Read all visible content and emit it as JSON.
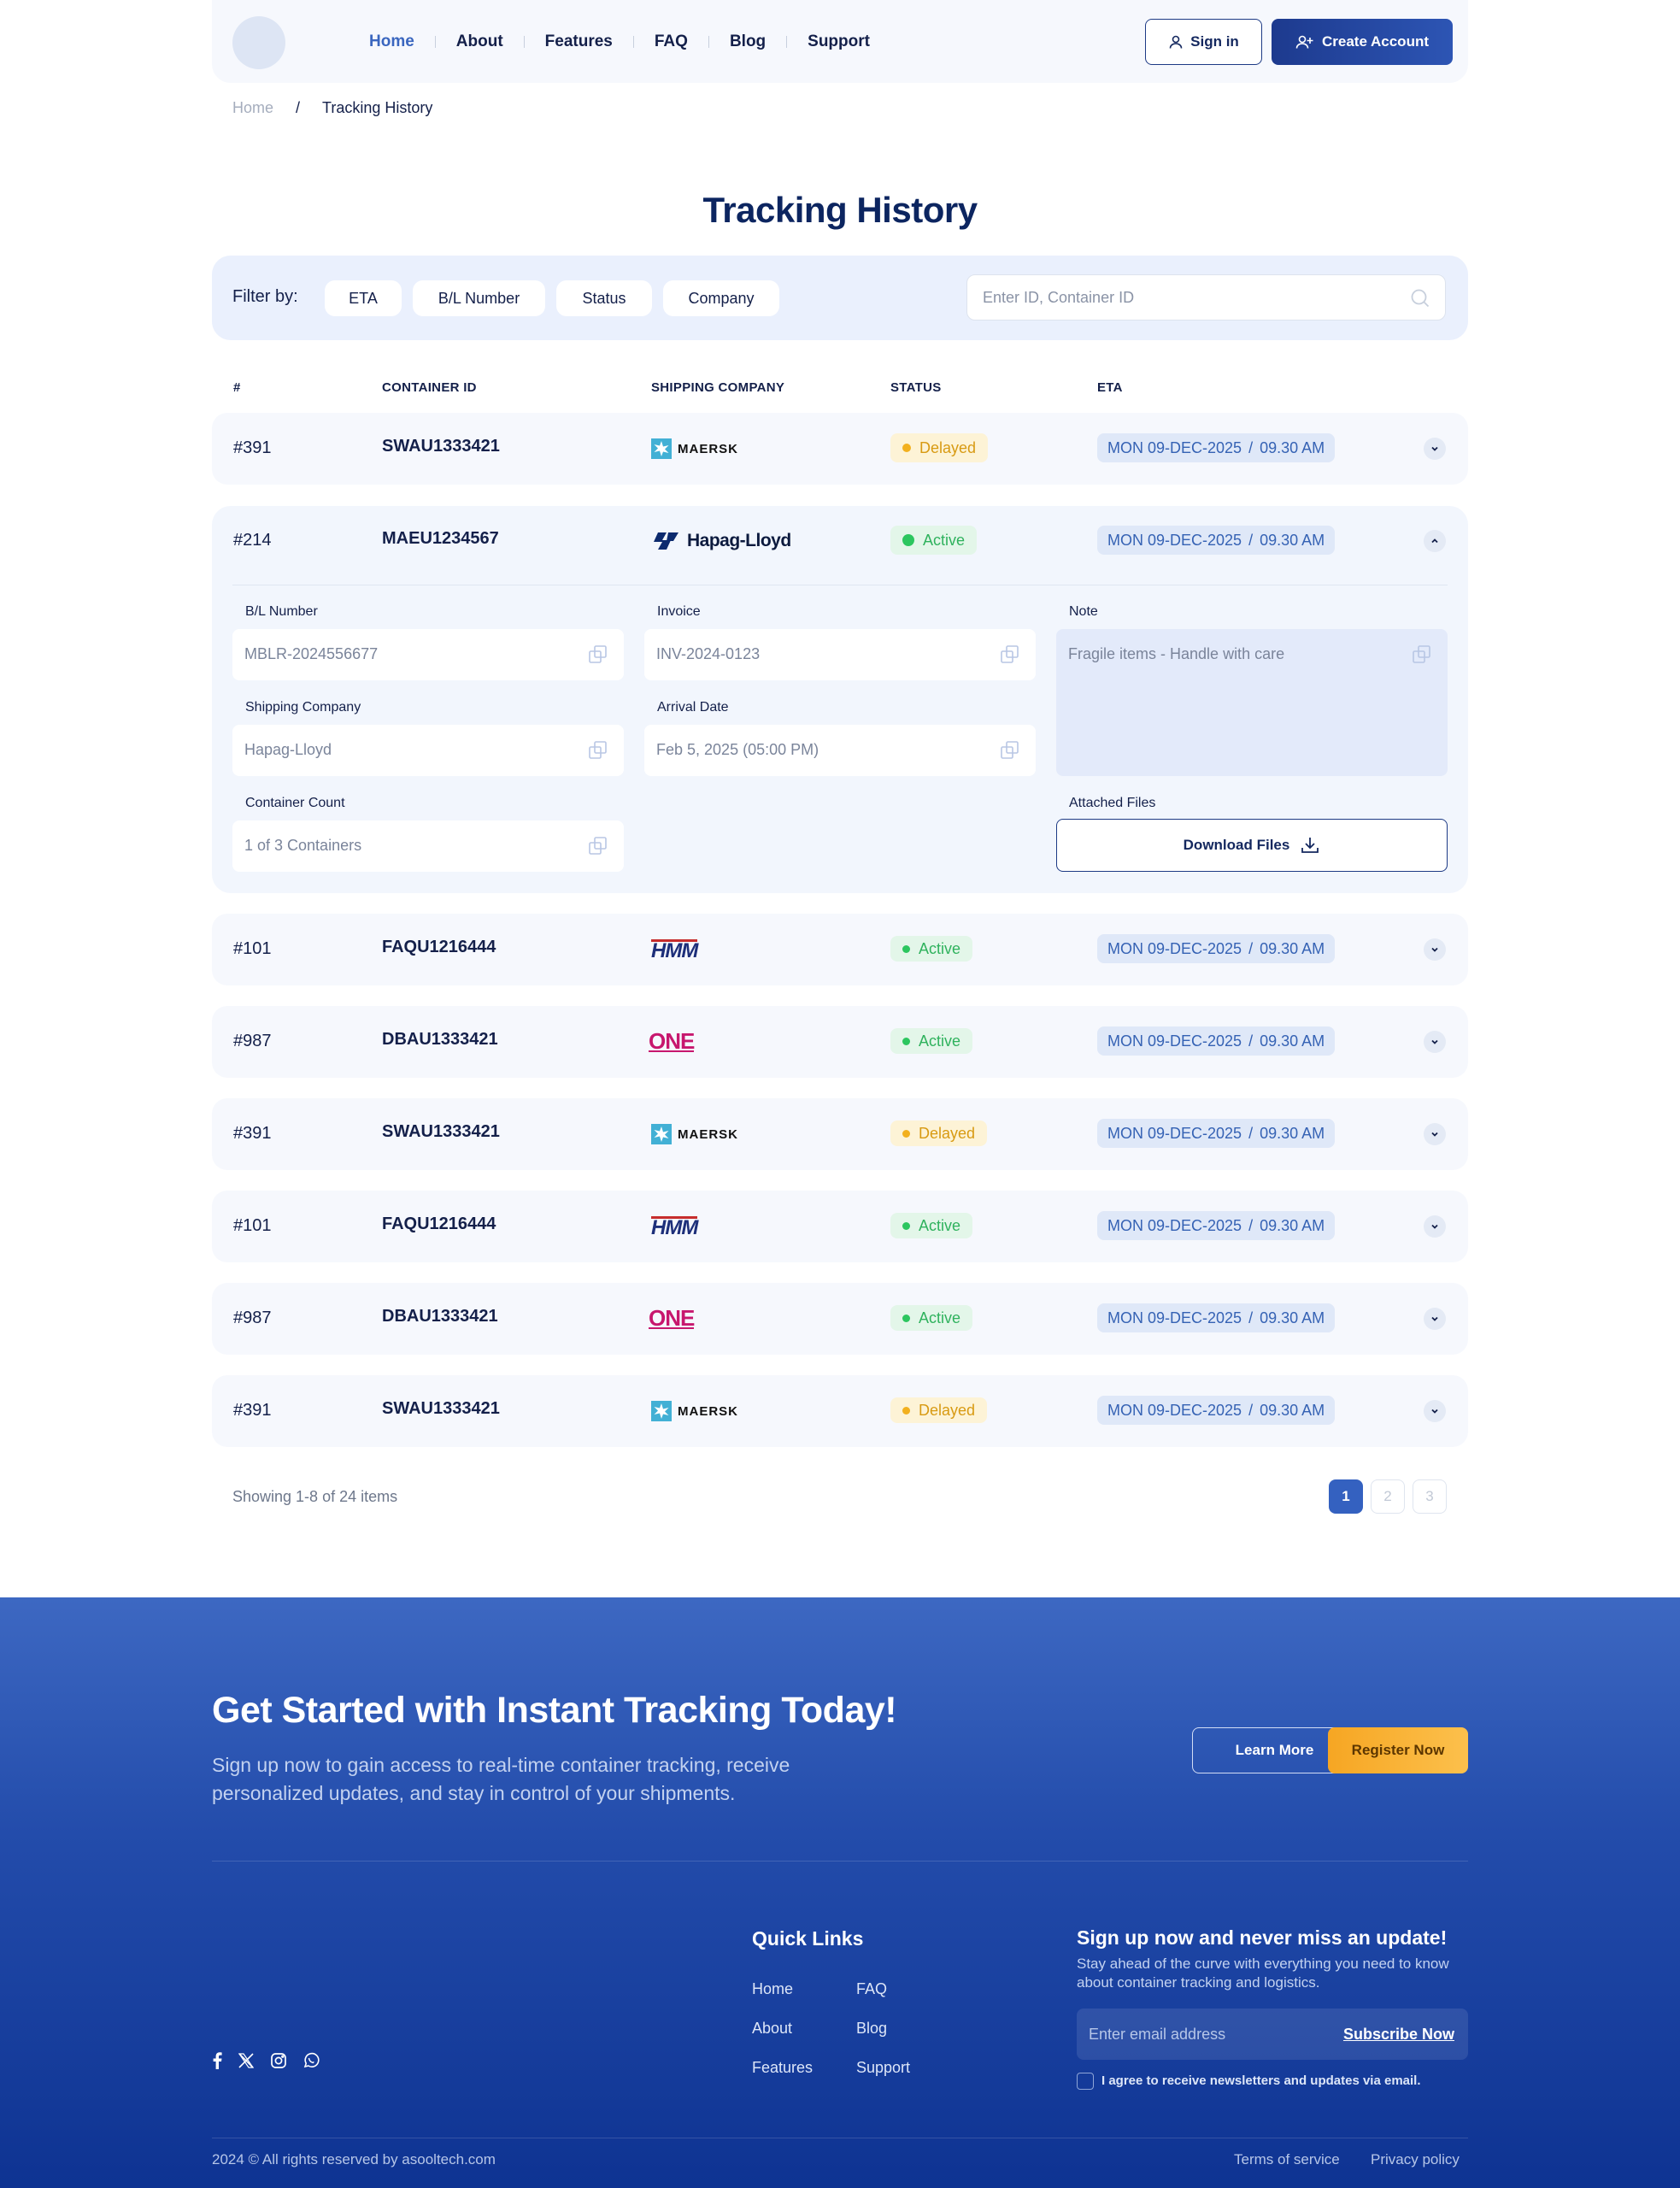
{
  "header": {
    "nav": [
      "Home",
      "About",
      "Features",
      "FAQ",
      "Blog",
      "Support"
    ],
    "active_nav": "Home",
    "sign_in": "Sign in",
    "create_account": "Create Account"
  },
  "breadcrumb": {
    "home": "Home",
    "separator": "/",
    "current": "Tracking History"
  },
  "page_title": "Tracking History",
  "filters": {
    "label": "Filter by:",
    "chips": [
      "ETA",
      "B/L Number",
      "Status",
      "Company"
    ],
    "search_placeholder": "Enter ID, Container ID"
  },
  "table": {
    "columns": [
      "#",
      "CONTAINER ID",
      "SHIPPING COMPANY",
      "STATUS",
      "ETA"
    ],
    "rows": [
      {
        "num": "#391",
        "id": "SWAU1333421",
        "company": "MAERSK",
        "status": "Delayed",
        "date": "MON 09-DEC-2025",
        "time": "09.30 AM",
        "expanded": false
      },
      {
        "num": "#214",
        "id": "MAEU1234567",
        "company": "Hapag-Lloyd",
        "status": "Active",
        "date": "MON 09-DEC-2025",
        "time": "09.30 AM",
        "expanded": true
      },
      {
        "num": "#101",
        "id": "FAQU1216444",
        "company": "HMM",
        "status": "Active",
        "date": "MON 09-DEC-2025",
        "time": "09.30 AM",
        "expanded": false
      },
      {
        "num": "#987",
        "id": "DBAU1333421",
        "company": "ONE",
        "status": "Active",
        "date": "MON 09-DEC-2025",
        "time": "09.30 AM",
        "expanded": false
      },
      {
        "num": "#391",
        "id": "SWAU1333421",
        "company": "MAERSK",
        "status": "Delayed",
        "date": "MON 09-DEC-2025",
        "time": "09.30 AM",
        "expanded": false
      },
      {
        "num": "#101",
        "id": "FAQU1216444",
        "company": "HMM",
        "status": "Active",
        "date": "MON 09-DEC-2025",
        "time": "09.30 AM",
        "expanded": false
      },
      {
        "num": "#987",
        "id": "DBAU1333421",
        "company": "ONE",
        "status": "Active",
        "date": "MON 09-DEC-2025",
        "time": "09.30 AM",
        "expanded": false
      },
      {
        "num": "#391",
        "id": "SWAU1333421",
        "company": "MAERSK",
        "status": "Delayed",
        "date": "MON 09-DEC-2025",
        "time": "09.30 AM",
        "expanded": false
      }
    ],
    "details": {
      "bl_label": "B/L Number",
      "bl_value": "MBLR-2024556677",
      "invoice_label": "Invoice",
      "invoice_value": "INV-2024-0123",
      "note_label": "Note",
      "note_value": "Fragile items - Handle with care",
      "company_label": "Shipping Company",
      "company_value": "Hapag-Lloyd",
      "arrival_label": "Arrival Date",
      "arrival_value": "Feb 5, 2025 (05:00 PM)",
      "count_label": "Container Count",
      "count_value": "1 of 3 Containers",
      "files_label": "Attached Files",
      "download": "Download Files"
    }
  },
  "pagination": {
    "showing": "Showing 1-8 of 24 items",
    "pages": [
      "1",
      "2",
      "3"
    ],
    "current": "1"
  },
  "footer": {
    "cta_title": "Get Started with Instant Tracking Today!",
    "cta_subtitle": "Sign up now to gain access to real-time container tracking, receive personalized updates, and stay in control of your shipments.",
    "learn_more": "Learn More",
    "register": "Register Now",
    "quick_links_title": "Quick Links",
    "quick_links": [
      "Home",
      "About",
      "Features",
      "FAQ",
      "Blog",
      "Support"
    ],
    "newsletter_title": "Sign up now and never miss an update!",
    "newsletter_subtitle": "Stay ahead of the curve with everything you need to know about container tracking and logistics.",
    "email_placeholder": "Enter email address",
    "subscribe": "Subscribe Now",
    "agree": "I agree to receive newsletters and updates via email.",
    "copyright": "2024 © All rights reserved by asooltech.com",
    "terms": "Terms of service",
    "privacy": "Privacy policy"
  },
  "colors": {
    "primary": "#1d3a8e",
    "accent": "#3461c0",
    "delayed": "#f2b01e",
    "active": "#2cc65f",
    "cta": "#f6a623",
    "maersk": "#42b0d5",
    "hapag": "#0c2a6e",
    "hmm": "#1d2f7a",
    "one": "#c7176e"
  }
}
